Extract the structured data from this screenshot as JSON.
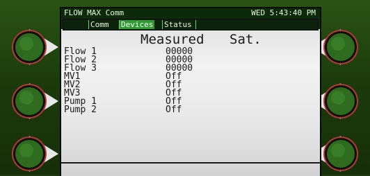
{
  "header": {
    "title": "FLOW MAX Comm",
    "clock": "WED 5:43:40 PM"
  },
  "tabs": [
    {
      "label": "Comm",
      "active": false
    },
    {
      "label": "Devices",
      "active": true
    },
    {
      "label": "Status",
      "active": false
    }
  ],
  "columns": {
    "measured": "Measured",
    "sat": "Sat."
  },
  "rows": [
    {
      "label": "Flow 1",
      "value": "00000"
    },
    {
      "label": "Flow 2",
      "value": "00000"
    },
    {
      "label": "Flow 3",
      "value": "00000"
    },
    {
      "label": "MV1",
      "value": "Off"
    },
    {
      "label": "MV2",
      "value": "Off"
    },
    {
      "label": "MV3",
      "value": "Off"
    },
    {
      "label": "Pump 1",
      "value": "Off"
    },
    {
      "label": "Pump 2",
      "value": "Off"
    }
  ],
  "colors": {
    "panel": "#1d3a0f",
    "active_tab": "#2f9a2f",
    "softkey_ring": "#b33a3a",
    "softkey_face": "#2f6b1f"
  }
}
